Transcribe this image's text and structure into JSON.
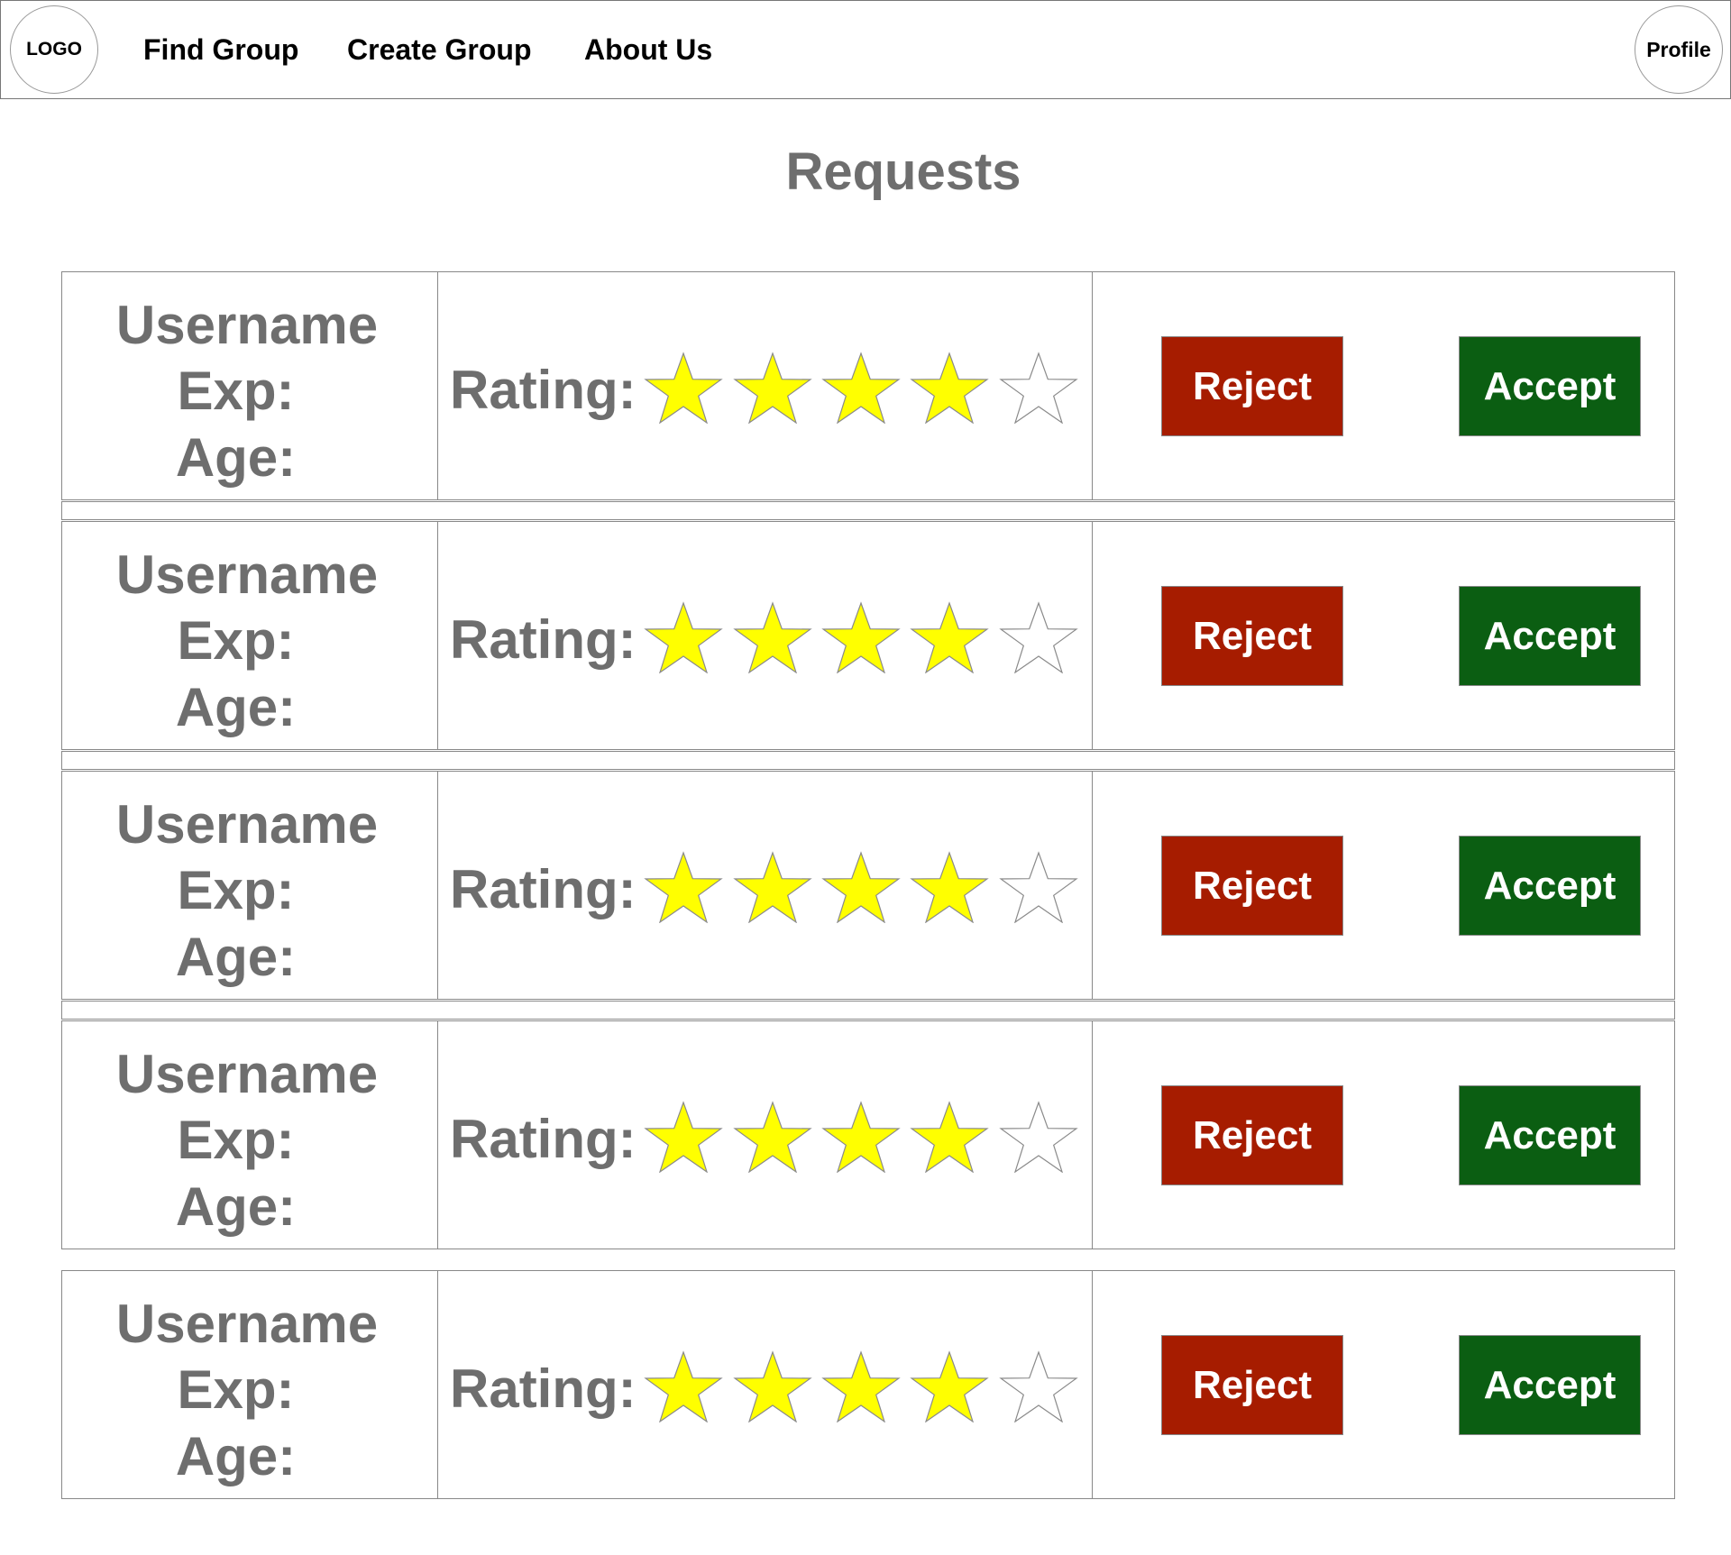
{
  "nav": {
    "logo": "LOGO",
    "links": [
      "Find Group",
      "Create Group",
      "About Us"
    ],
    "profile": "Profile"
  },
  "page_title": "Requests",
  "requests": [
    {
      "username": "Username",
      "exp": "Exp:",
      "age": "Age:",
      "rating_label": "Rating:",
      "rating": 4,
      "max_rating": 5,
      "reject_label": "Reject",
      "accept_label": "Accept"
    },
    {
      "username": "Username",
      "exp": "Exp:",
      "age": "Age:",
      "rating_label": "Rating:",
      "rating": 4,
      "max_rating": 5,
      "reject_label": "Reject",
      "accept_label": "Accept"
    },
    {
      "username": "Username",
      "exp": "Exp:",
      "age": "Age:",
      "rating_label": "Rating:",
      "rating": 4,
      "max_rating": 5,
      "reject_label": "Reject",
      "accept_label": "Accept"
    },
    {
      "username": "Username",
      "exp": "Exp:",
      "age": "Age:",
      "rating_label": "Rating:",
      "rating": 4,
      "max_rating": 5,
      "reject_label": "Reject",
      "accept_label": "Accept"
    },
    {
      "username": "Username",
      "exp": "Exp:",
      "age": "Age:",
      "rating_label": "Rating:",
      "rating": 4,
      "max_rating": 5,
      "reject_label": "Reject",
      "accept_label": "Accept"
    }
  ],
  "colors": {
    "reject": "#a61c00",
    "accept": "#0b5e12",
    "star_filled": "#ffff00",
    "star_empty": "#ffffff",
    "muted_text": "#6e6e6e"
  },
  "icons": {
    "star": "star-icon"
  }
}
